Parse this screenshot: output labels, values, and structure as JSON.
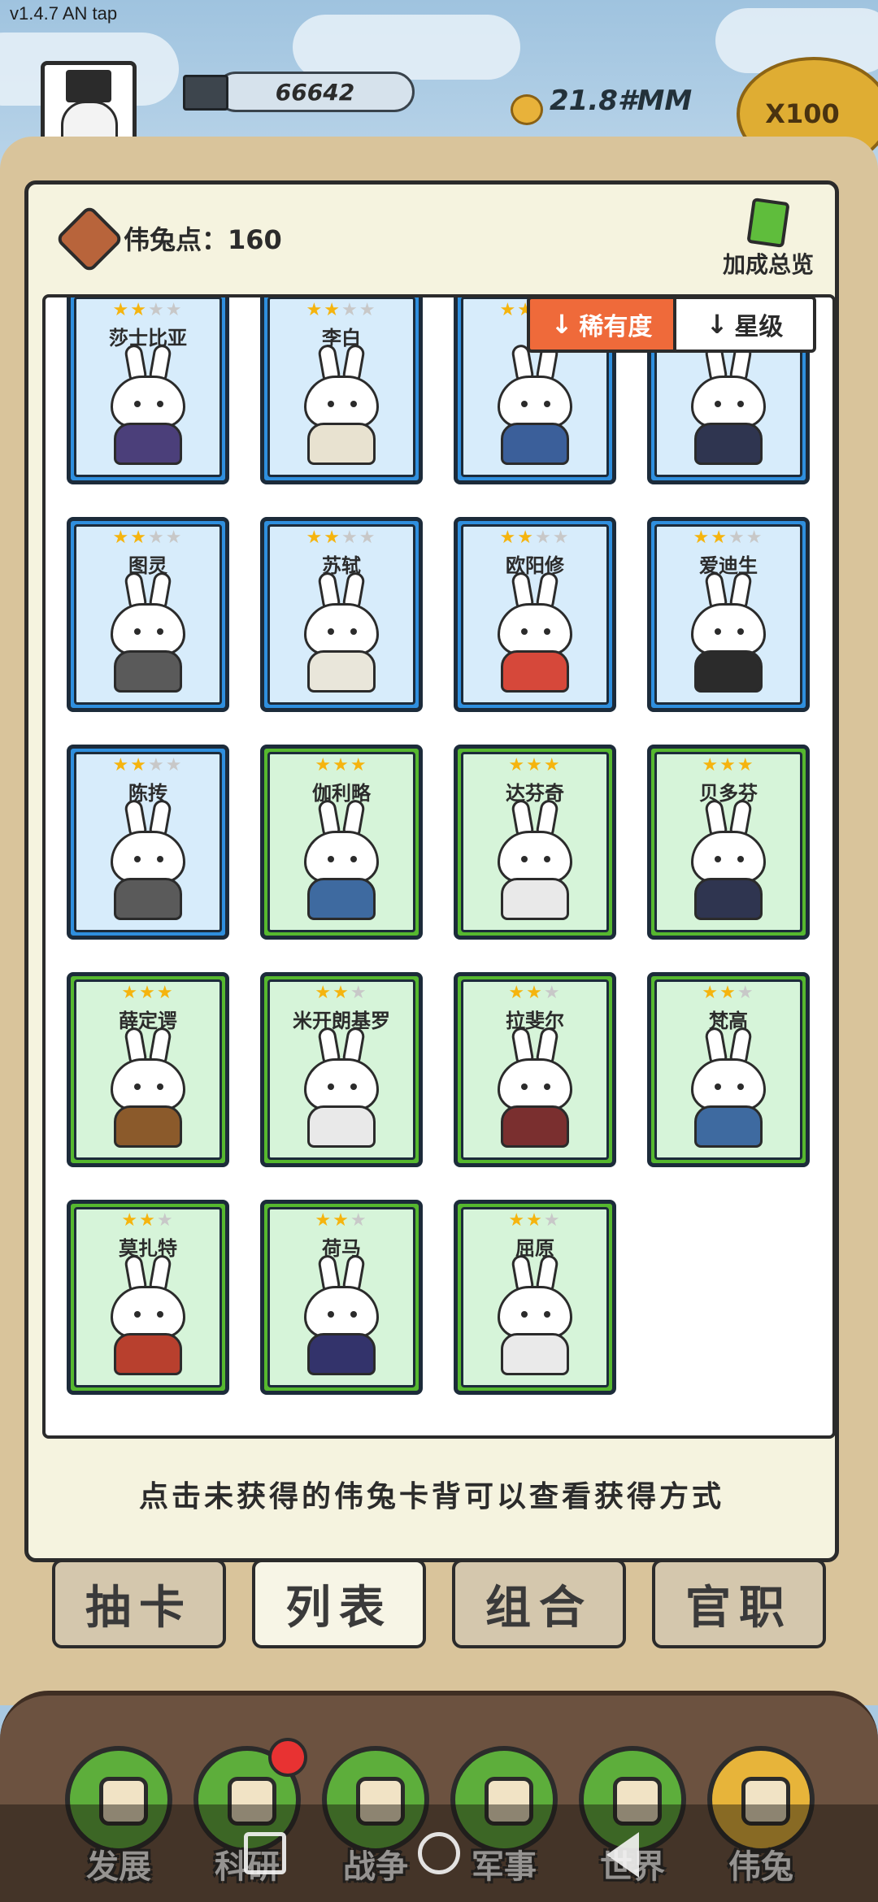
{
  "version": "v1.4.7 AN tap",
  "hud": {
    "resource_value": "66642",
    "coin_value": "21.8#MM",
    "multiplier": "X100",
    "colors": {
      "coin": "#e8b23a",
      "multiplier_bg": "#dfad33"
    }
  },
  "panel": {
    "points_label": "伟兔点：",
    "points_value": "160",
    "bonus_button": "加成总览",
    "sort": {
      "rarity_label": "稀有度",
      "star_label": "星级",
      "arrow_icon": "arrow-down-icon"
    },
    "hint": "点击未获得的伟兔卡背可以查看获得方式"
  },
  "cards": [
    {
      "name": "莎士比亚",
      "stars": 2,
      "max": 4,
      "rarity": "blue"
    },
    {
      "name": "李白",
      "stars": 2,
      "max": 4,
      "rarity": "blue"
    },
    {
      "name": "",
      "stars": 2,
      "max": 4,
      "rarity": "blue"
    },
    {
      "name": "",
      "stars": 2,
      "max": 4,
      "rarity": "blue"
    },
    {
      "name": "图灵",
      "stars": 2,
      "max": 4,
      "rarity": "blue"
    },
    {
      "name": "苏轼",
      "stars": 2,
      "max": 4,
      "rarity": "blue"
    },
    {
      "name": "欧阳修",
      "stars": 2,
      "max": 4,
      "rarity": "blue"
    },
    {
      "name": "爱迪生",
      "stars": 2,
      "max": 4,
      "rarity": "blue"
    },
    {
      "name": "陈抟",
      "stars": 2,
      "max": 4,
      "rarity": "blue"
    },
    {
      "name": "伽利略",
      "stars": 3,
      "max": 3,
      "rarity": "green"
    },
    {
      "name": "达芬奇",
      "stars": 3,
      "max": 3,
      "rarity": "green"
    },
    {
      "name": "贝多芬",
      "stars": 3,
      "max": 3,
      "rarity": "green"
    },
    {
      "name": "薛定谔",
      "stars": 3,
      "max": 3,
      "rarity": "green"
    },
    {
      "name": "米开朗基罗",
      "stars": 2,
      "max": 3,
      "rarity": "green"
    },
    {
      "name": "拉斐尔",
      "stars": 2,
      "max": 3,
      "rarity": "green"
    },
    {
      "name": "梵高",
      "stars": 2,
      "max": 3,
      "rarity": "green"
    },
    {
      "name": "莫扎特",
      "stars": 2,
      "max": 3,
      "rarity": "green"
    },
    {
      "name": "荷马",
      "stars": 2,
      "max": 3,
      "rarity": "green"
    },
    {
      "name": "屈原",
      "stars": 2,
      "max": 3,
      "rarity": "green"
    }
  ],
  "tabs": [
    "抽卡",
    "列表",
    "组合",
    "官职"
  ],
  "active_tab": "列表",
  "bottom_nav": [
    {
      "label": "发展",
      "icon": "growth-icon"
    },
    {
      "label": "科研",
      "icon": "flask-icon",
      "badge": true
    },
    {
      "label": "战争",
      "icon": "crossed-swords-icon"
    },
    {
      "label": "军事",
      "icon": "helmet-icon"
    },
    {
      "label": "世界",
      "icon": "globe-icon"
    },
    {
      "label": "伟兔",
      "icon": "bunny-card-icon",
      "active": true
    }
  ]
}
